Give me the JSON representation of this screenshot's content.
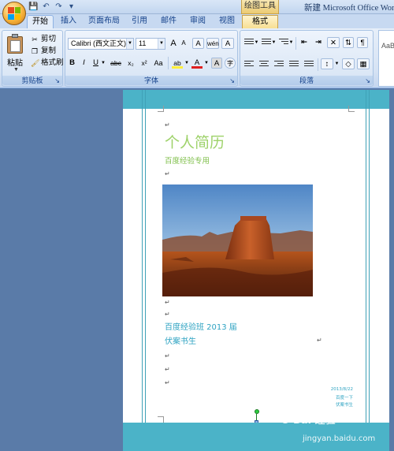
{
  "titlebar": {
    "window_title": "新建 Microsoft Office Word",
    "context_tab_header": "绘图工具",
    "qat": {
      "save": "💾",
      "undo": "↶",
      "redo": "↷",
      "customize": "▾"
    }
  },
  "tabs": [
    {
      "label": "开始",
      "active": true
    },
    {
      "label": "插入"
    },
    {
      "label": "页面布局"
    },
    {
      "label": "引用"
    },
    {
      "label": "邮件"
    },
    {
      "label": "审阅"
    },
    {
      "label": "视图"
    },
    {
      "label": "格式",
      "contextual": true
    }
  ],
  "clipboard": {
    "group_label": "剪贴板",
    "paste": "粘贴",
    "cut": "剪切",
    "copy": "复制",
    "format_painter": "格式刷"
  },
  "font": {
    "group_label": "字体",
    "font_name": "Calibri (西文正文)",
    "font_size": "11",
    "grow": "A",
    "shrink": "A",
    "clear": "A",
    "pinyin": "wén",
    "bold": "B",
    "italic": "I",
    "underline": "U",
    "strike": "abc",
    "subscript": "x₂",
    "superscript": "x²",
    "change_case": "Aa",
    "highlight": "ab",
    "font_color": "A",
    "char_shading": "A",
    "enclose": "字"
  },
  "paragraph": {
    "group_label": "段落"
  },
  "styles": {
    "preview": "AaBb"
  },
  "document": {
    "title": "个人简历",
    "subtitle": "百度经验专用",
    "line1": "百度经验班 2013 届",
    "line2": "伏案书生",
    "note_lines": [
      "2013/8/22",
      "百度一下",
      "伏案书生"
    ],
    "para_mark": "↵"
  },
  "watermark": {
    "brand": "Bai 经验",
    "url": "jingyan.baidu.com"
  },
  "colors": {
    "title_green": "#9ed26a",
    "text_blue": "#2ea3c2",
    "band_teal": "#4bb3c8"
  }
}
